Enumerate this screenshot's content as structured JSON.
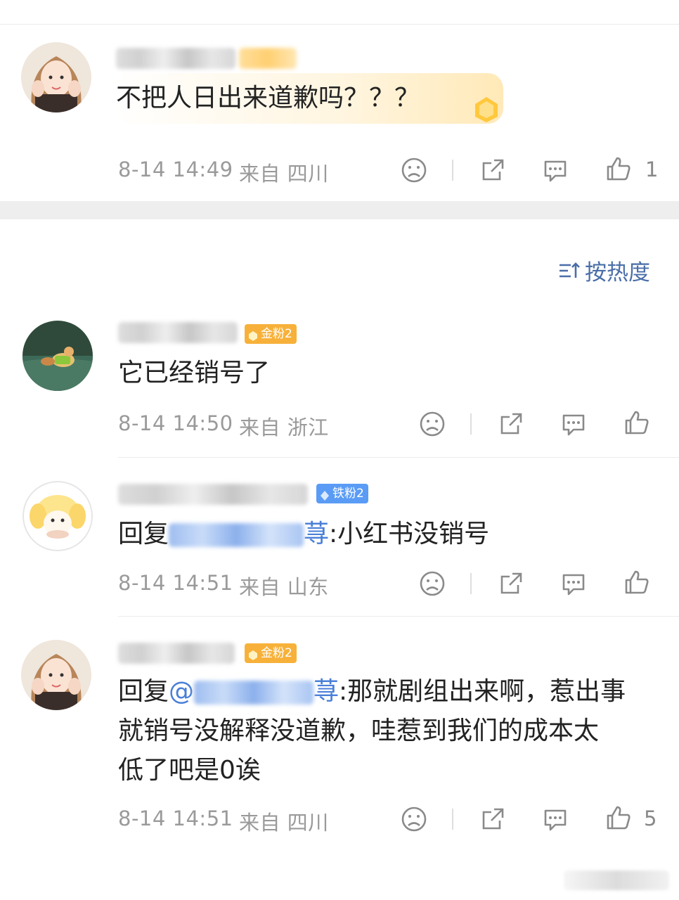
{
  "comments": [
    {
      "content": "不把人日出来道歉吗？？？",
      "time": "8-14 14:49",
      "location": "来自 四川",
      "like_count": "1"
    },
    {
      "badge": "金粉2",
      "content": "它已经销号了",
      "time": "8-14 14:50",
      "location": "来自 浙江",
      "like_count": ""
    },
    {
      "badge": "铁粉2",
      "reply_prefix": "回复",
      "mention_tail": "荨",
      "content": ":小红书没销号",
      "time": "8-14 14:51",
      "location": "来自 山东",
      "like_count": ""
    },
    {
      "badge": "金粉2",
      "reply_prefix": "回复",
      "mention_head": "@",
      "mention_tail": "荨",
      "content_line1": ":那就剧组出来啊，惹出事",
      "content_line2": "就销号没解释没道歉，哇惹到我们的成本太",
      "content_line3": "低了吧是0诶",
      "time": "8-14 14:51",
      "location": "来自 四川",
      "like_count": "5"
    }
  ],
  "sort": {
    "label": "按热度"
  },
  "icons": {
    "dislike": "sad-face-icon",
    "share": "share-icon",
    "comment": "comment-icon",
    "like": "thumbs-up-icon",
    "sort": "sort-icon"
  },
  "colors": {
    "accent": "#4a6ea8",
    "mention": "#4a7fd8",
    "gold_badge": "#f7b13a",
    "iron_badge": "#5a9cf5",
    "meta": "#9a9a9a"
  }
}
